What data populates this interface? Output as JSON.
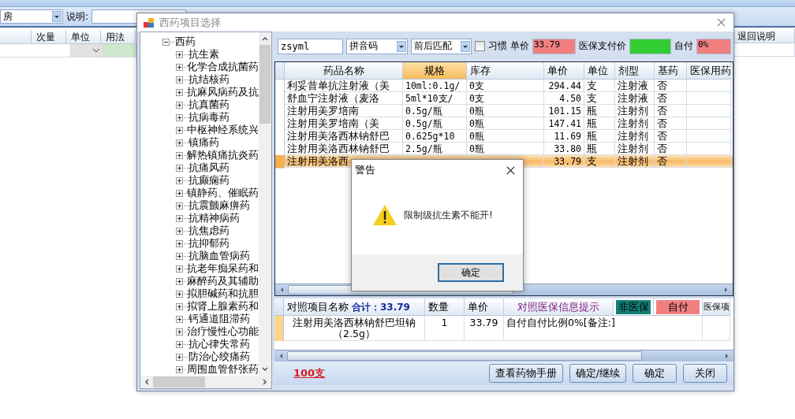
{
  "background": {
    "location": "房",
    "note_label": "说明:",
    "columns": [
      "次量",
      "单位",
      "用法"
    ],
    "return_column": "退回说明"
  },
  "dialog": {
    "title": "西药项目选择",
    "tree": [
      {
        "label": "西药",
        "expanded": true,
        "children": [
          {
            "label": "抗生素",
            "expanded": false
          },
          {
            "label": "化学合成抗菌药",
            "expanded": false
          },
          {
            "label": "抗结核药",
            "expanded": false
          },
          {
            "label": "抗麻风病药及抗",
            "expanded": false
          },
          {
            "label": "抗真菌药",
            "expanded": false
          },
          {
            "label": "抗病毒药",
            "expanded": false
          },
          {
            "label": "中枢神经系统兴",
            "expanded": false
          },
          {
            "label": "镇痛药",
            "expanded": false
          },
          {
            "label": "解热镇痛抗炎药",
            "expanded": false
          },
          {
            "label": "抗痛风药",
            "expanded": false
          },
          {
            "label": "抗癫痫药",
            "expanded": false
          },
          {
            "label": "镇静药、催眠药",
            "expanded": false
          },
          {
            "label": "抗震颤麻痹药",
            "expanded": false
          },
          {
            "label": "抗精神病药",
            "expanded": false
          },
          {
            "label": "抗焦虑药",
            "expanded": false
          },
          {
            "label": "抗抑郁药",
            "expanded": false
          },
          {
            "label": "抗脑血管病药",
            "expanded": false
          },
          {
            "label": "抗老年痴呆药和",
            "expanded": false
          },
          {
            "label": "麻醉药及其辅助",
            "expanded": false
          },
          {
            "label": "拟胆碱药和抗胆",
            "expanded": false
          },
          {
            "label": "拟肾上腺素药和",
            "expanded": false
          },
          {
            "label": "钙通道阻滞药",
            "expanded": false
          },
          {
            "label": "治疗慢性心功能",
            "expanded": false
          },
          {
            "label": "抗心律失常药",
            "expanded": false
          },
          {
            "label": "防治心绞痛药",
            "expanded": false
          },
          {
            "label": "周围血管舒张药",
            "expanded": false
          }
        ]
      }
    ],
    "search": {
      "value": "zsyml",
      "code_type": "拼音码",
      "match_mode": "前后匹配",
      "habit": {
        "label": "习惯",
        "checked": false
      },
      "price_label": "单价",
      "price": "33.79",
      "insurance_label": "医保支付价",
      "self_pay_label": "自付",
      "self_pay": "0%"
    },
    "grid": {
      "columns": [
        {
          "label": "药品名称",
          "selected": false
        },
        {
          "label": "规格",
          "selected": true
        },
        {
          "label": "库存",
          "selected": false
        },
        {
          "label": "单价",
          "selected": false
        },
        {
          "label": "单位",
          "selected": false
        },
        {
          "label": "剂型",
          "selected": false
        },
        {
          "label": "基药",
          "selected": false
        },
        {
          "label": "医保用药",
          "selected": false
        }
      ],
      "rows": [
        {
          "selected": false,
          "cells": [
            "利妥昔单抗注射液（美",
            "10ml:0.1g/",
            "0支",
            "294.44",
            "支",
            "注射液",
            "否",
            null
          ]
        },
        {
          "selected": false,
          "cells": [
            "舒血宁注射液（麦洛",
            "5ml*10支/",
            "0支",
            "4.50",
            "支",
            "注射液",
            "否",
            null
          ]
        },
        {
          "selected": false,
          "cells": [
            "注射用美罗培南",
            "0.5g/瓶",
            "0瓶",
            "101.15",
            "瓶",
            "注射剂",
            "否",
            null
          ]
        },
        {
          "selected": false,
          "cells": [
            "注射用美罗培南（美",
            "0.5g/瓶",
            "0瓶",
            "147.41",
            "瓶",
            "注射剂",
            "否",
            null
          ]
        },
        {
          "selected": false,
          "cells": [
            "注射用美洛西林钠舒巴",
            "0.625g*10",
            "0瓶",
            "11.69",
            "瓶",
            "注射剂",
            "否",
            null
          ]
        },
        {
          "selected": false,
          "cells": [
            "注射用美洛西林钠舒巴",
            "2.5g/瓶",
            "0瓶",
            "33.80",
            "瓶",
            "注射剂",
            "否",
            null
          ]
        },
        {
          "selected": true,
          "cells": [
            "注射用美洛西",
            null,
            null,
            "33.79",
            "支",
            "注射剂",
            "否",
            null
          ]
        }
      ]
    },
    "summary": {
      "columns": [
        {
          "label": "对照项目名称",
          "kind": "name"
        },
        {
          "label": "数量",
          "kind": "plain"
        },
        {
          "label": "单价",
          "kind": "plain"
        },
        {
          "label": "对照医保信息提示",
          "kind": "hint"
        },
        {
          "label": "非医保",
          "kind": "flag",
          "color": "#138075"
        },
        {
          "label": "自付",
          "kind": "flag",
          "color": "#f08080"
        },
        {
          "label": "医保项",
          "kind": "plain"
        }
      ],
      "total": "合计：33.79",
      "rows": [
        {
          "cells": [
            "注射用美洛西林钠舒巴坦钠（2.5g）",
            "1",
            "33.79",
            "自付自付比例0%[备注:]"
          ]
        }
      ]
    },
    "stock": "100支",
    "buttons": [
      "查看药物手册",
      "确定/继续",
      "确定",
      "关闭"
    ]
  },
  "alert": {
    "title": "警告",
    "message": "限制级抗生素不能开!",
    "button": "确定"
  }
}
